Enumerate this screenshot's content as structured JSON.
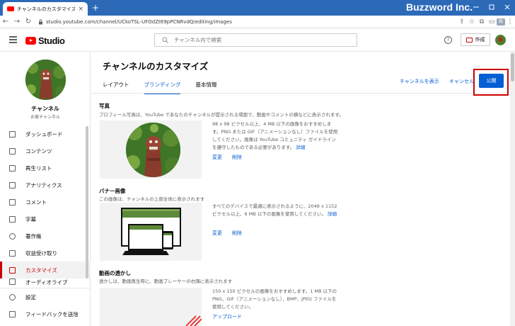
{
  "browser": {
    "tab_title": "チャンネルのカスタマイズ - YouTube Studio",
    "tab_close": "×",
    "new_tab": "+",
    "url": "studio.youtube.com/channel/UCkoTSL-UFOdZt69pPCNRvdQ/editing/images",
    "profile_badge": "設"
  },
  "watermark": "Buzzword Inc.",
  "studio": {
    "logo_text": "Studio",
    "search_placeholder": "チャンネル内で検索",
    "help": "?",
    "create_label": "作成"
  },
  "sidebar": {
    "channel_name": "チャンネル",
    "channel_sub": "お客チャンネル",
    "items": [
      {
        "label": "ダッシュボード",
        "icon": "dashboard-icon"
      },
      {
        "label": "コンテンツ",
        "icon": "content-icon"
      },
      {
        "label": "再生リスト",
        "icon": "playlist-icon"
      },
      {
        "label": "アナリティクス",
        "icon": "analytics-icon"
      },
      {
        "label": "コメント",
        "icon": "comment-icon"
      },
      {
        "label": "字幕",
        "icon": "subtitles-icon"
      },
      {
        "label": "著作権",
        "icon": "copyright-icon"
      },
      {
        "label": "収益受け取り",
        "icon": "monetization-icon"
      },
      {
        "label": "カスタマイズ",
        "icon": "customize-icon"
      }
    ],
    "partial_item": "オーディオライブ",
    "bottom": [
      {
        "label": "設定",
        "icon": "settings-icon"
      },
      {
        "label": "フィードバックを送信",
        "icon": "feedback-icon"
      }
    ]
  },
  "main": {
    "title": "チャンネルのカスタマイズ",
    "tabs": [
      "レイアウト",
      "ブランディング",
      "基本情報"
    ],
    "active_tab": 1,
    "view_channel": "チャンネルを表示",
    "cancel": "キャンセル",
    "publish": "公開",
    "photo": {
      "title": "写真",
      "desc": "プロフィール写真は、YouTube であなたのチャンネルが提示される場面で、動画やコメントの横などに表示されます。",
      "info": "98 x 98 ピクセル以上、4 MB 以下の画像をおすすめします。PNG または GIF（アニメーションなし）ファイルを使用してください。画像は YouTube コミュニティ ガイドラインを遵守したものである必要があります。",
      "more": "詳細",
      "change": "変更",
      "remove": "削除"
    },
    "banner": {
      "title": "バナー画像",
      "desc": "この画像は、チャンネルの上部全体に表示されます",
      "info": "すべてのデバイスで最適に表示されるように、2048 x 1152 ピクセル以上、6 MB 以下の画像を使用してください。",
      "more": "詳細",
      "change": "変更",
      "remove": "削除"
    },
    "watermark": {
      "title": "動画の透かし",
      "desc": "透かしは、動画再生時に、動画プレーヤーの右隅に表示されます",
      "info": "150 x 150 ピクセルの画像をおすすめします。1 MB 以下の PNG、GIF（アニメーションなし）、BMP、JPEG ファイルを使用してください。",
      "upload": "アップロード"
    }
  },
  "colors": {
    "chrome_blue": "#2c6ab8",
    "accent_blue": "#065fd4",
    "active_red": "#cc0000",
    "highlight_red": "#d00000"
  }
}
